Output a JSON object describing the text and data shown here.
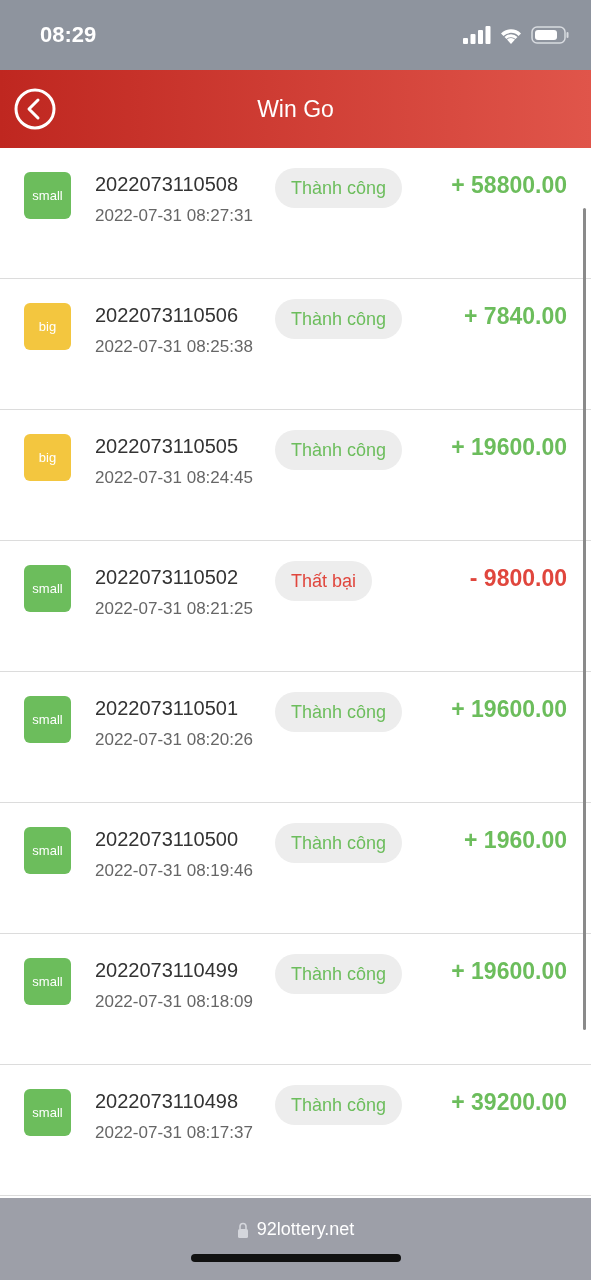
{
  "status_bar": {
    "time": "08:29"
  },
  "header": {
    "title": "Win Go"
  },
  "records": [
    {
      "tag": {
        "text": "small",
        "kind": "small"
      },
      "issue": "2022073110508",
      "time": "2022-07-31 08:27:31",
      "status": {
        "text": "Thành công",
        "kind": "success"
      },
      "amount": "+ 58800.00"
    },
    {
      "tag": {
        "text": "big",
        "kind": "big"
      },
      "issue": "2022073110506",
      "time": "2022-07-31 08:25:38",
      "status": {
        "text": "Thành công",
        "kind": "success"
      },
      "amount": "+ 7840.00"
    },
    {
      "tag": {
        "text": "big",
        "kind": "big"
      },
      "issue": "2022073110505",
      "time": "2022-07-31 08:24:45",
      "status": {
        "text": "Thành công",
        "kind": "success"
      },
      "amount": "+ 19600.00"
    },
    {
      "tag": {
        "text": "small",
        "kind": "small"
      },
      "issue": "2022073110502",
      "time": "2022-07-31 08:21:25",
      "status": {
        "text": "Thất bại",
        "kind": "fail"
      },
      "amount": "- 9800.00"
    },
    {
      "tag": {
        "text": "small",
        "kind": "small"
      },
      "issue": "2022073110501",
      "time": "2022-07-31 08:20:26",
      "status": {
        "text": "Thành công",
        "kind": "success"
      },
      "amount": "+ 19600.00"
    },
    {
      "tag": {
        "text": "small",
        "kind": "small"
      },
      "issue": "2022073110500",
      "time": "2022-07-31 08:19:46",
      "status": {
        "text": "Thành công",
        "kind": "success"
      },
      "amount": "+ 1960.00"
    },
    {
      "tag": {
        "text": "small",
        "kind": "small"
      },
      "issue": "2022073110499",
      "time": "2022-07-31 08:18:09",
      "status": {
        "text": "Thành công",
        "kind": "success"
      },
      "amount": "+ 19600.00"
    },
    {
      "tag": {
        "text": "small",
        "kind": "small"
      },
      "issue": "2022073110498",
      "time": "2022-07-31 08:17:37",
      "status": {
        "text": "Thành công",
        "kind": "success"
      },
      "amount": "+ 39200.00"
    }
  ],
  "address_bar": {
    "url": "92lottery.net"
  }
}
